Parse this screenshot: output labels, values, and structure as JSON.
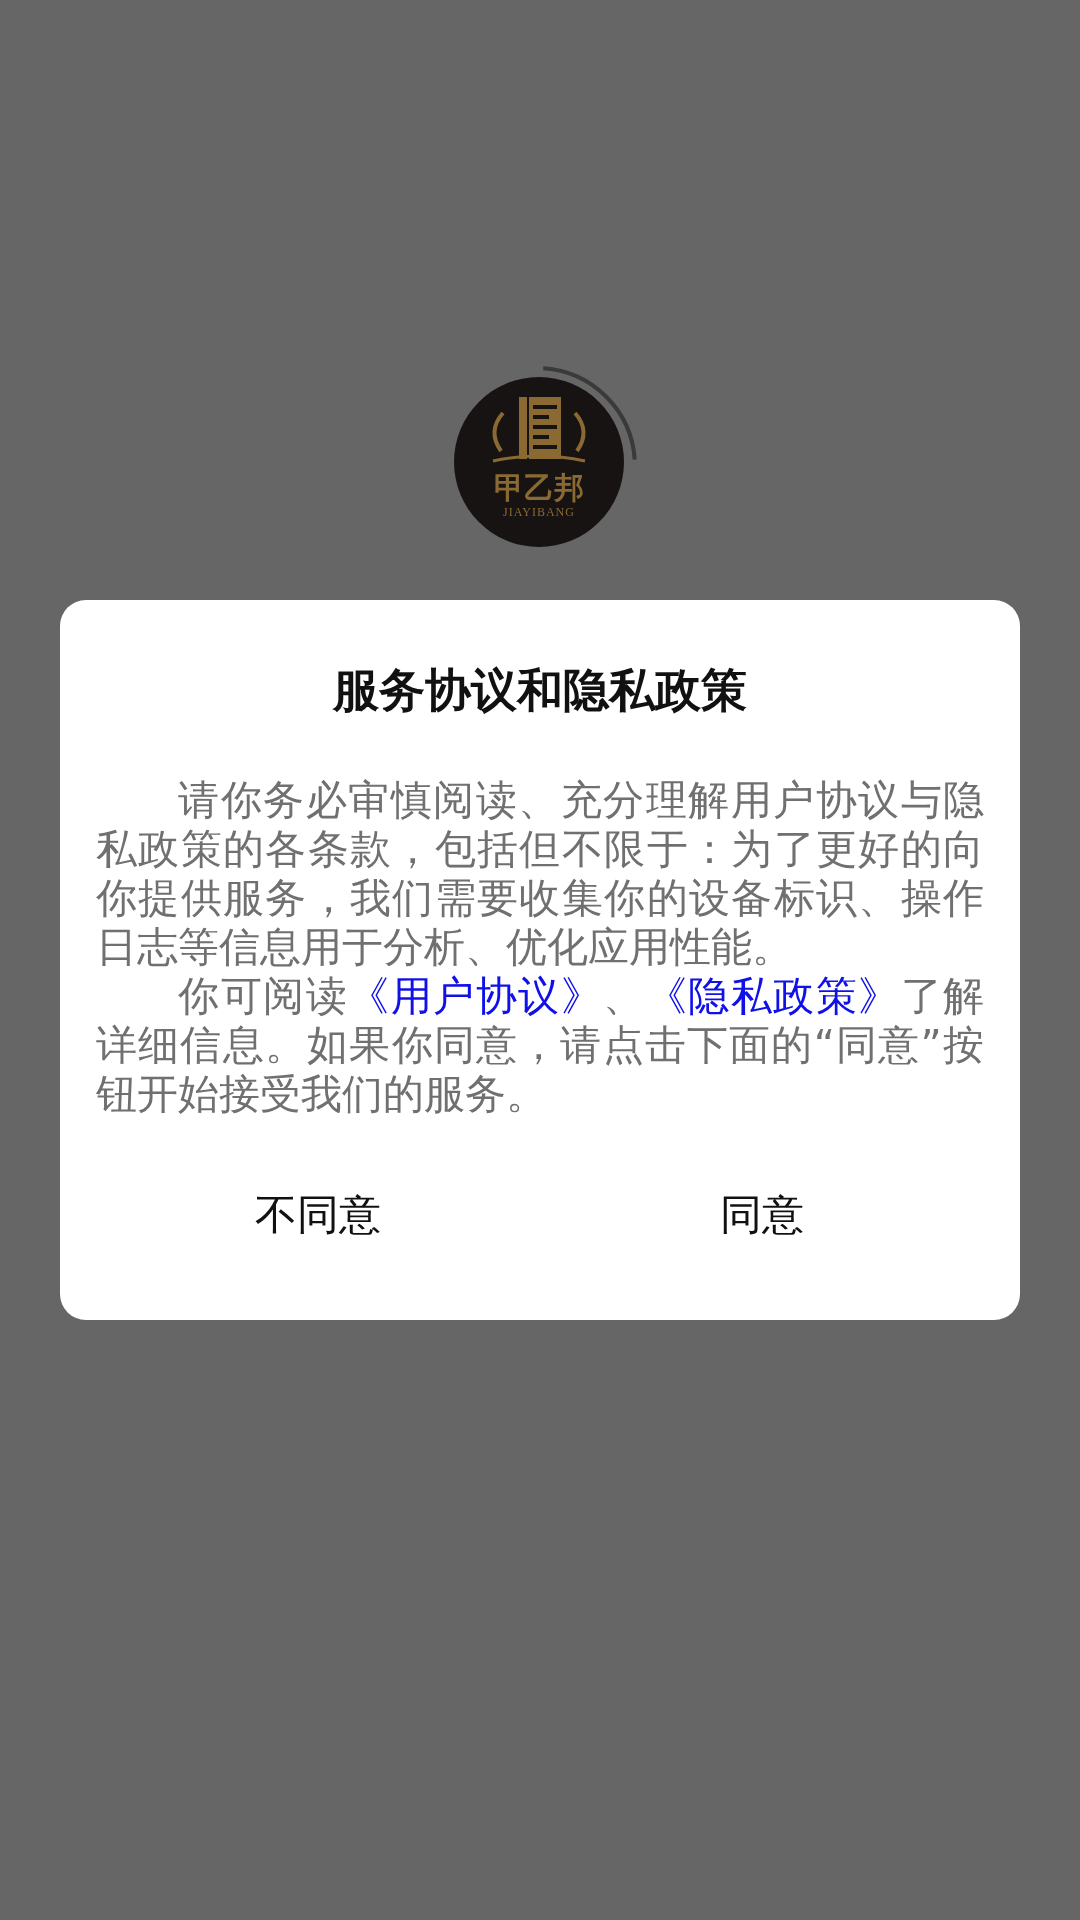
{
  "logo": {
    "name": "甲乙邦",
    "subtitle": "JIAYIBANG"
  },
  "dialog": {
    "title": "服务协议和隐私政策",
    "paragraphs": [
      [
        {
          "kind": "text",
          "text": "请你务必审慎阅读、充分理解用户协议与隐私政策的各条款，包括但不限于：为了更好的向你提供服务，我们需要收集你的设备标识、操作日志等信息用于分析、优化应用性能。"
        }
      ],
      [
        {
          "kind": "text",
          "text": "你可阅读"
        },
        {
          "kind": "link",
          "text": "《用户协议》"
        },
        {
          "kind": "text",
          "text": "、"
        },
        {
          "kind": "link",
          "text": "《隐私政策》"
        },
        {
          "kind": "text",
          "text": "了解详细信息。如果你同意，请点击下面的“同意”按钮开始接受我们的服务。"
        }
      ]
    ],
    "buttons": [
      {
        "label": "不同意"
      },
      {
        "label": "同意"
      }
    ]
  }
}
